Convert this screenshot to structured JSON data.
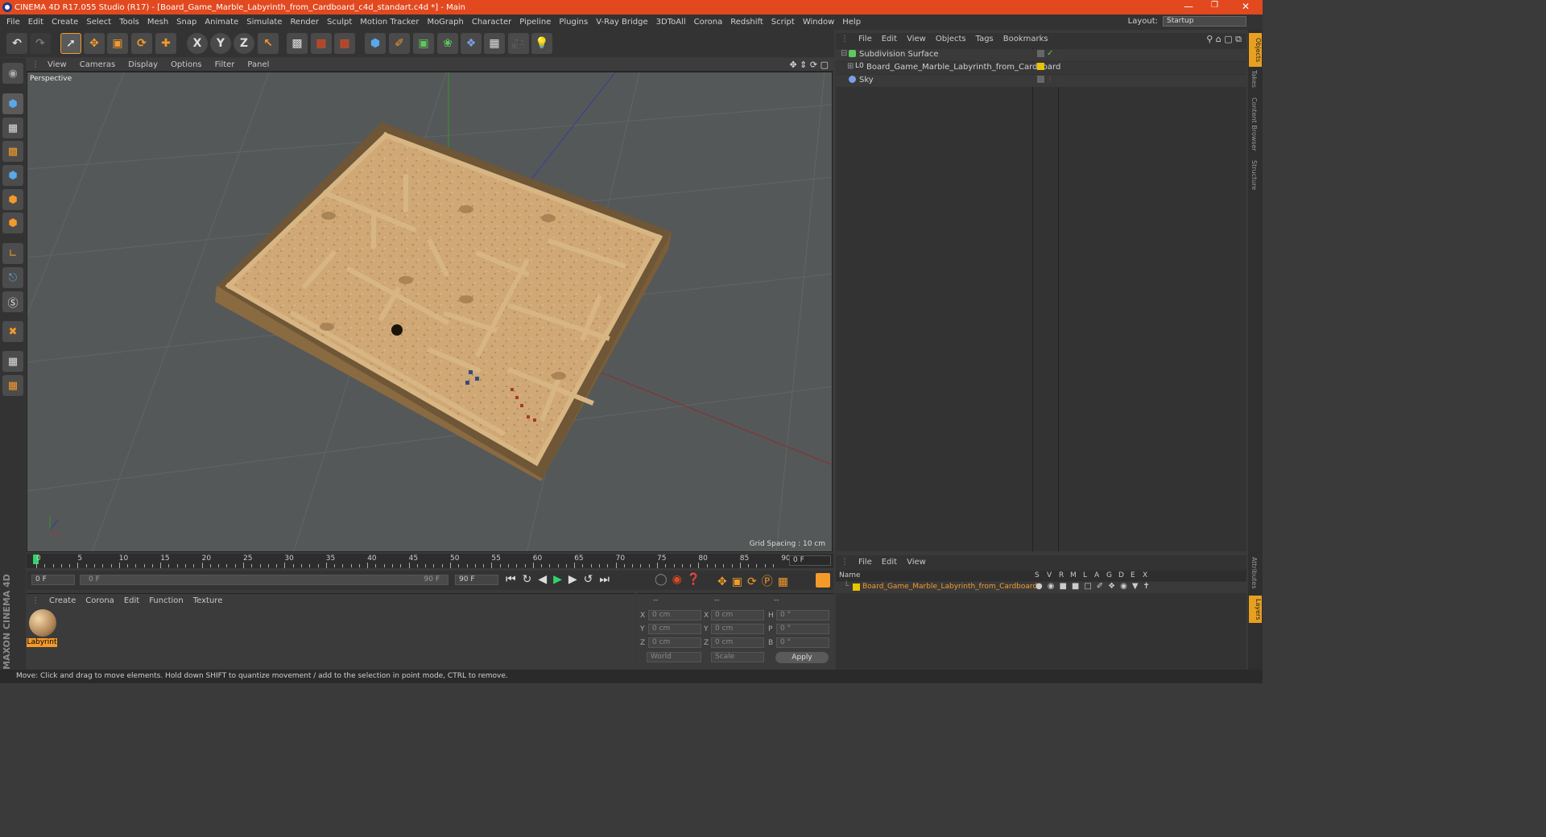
{
  "window": {
    "title": "CINEMA 4D R17.055 Studio (R17) - [Board_Game_Marble_Labyrinth_from_Cardboard_c4d_standart.c4d *] - Main"
  },
  "menu": [
    "File",
    "Edit",
    "Create",
    "Select",
    "Tools",
    "Mesh",
    "Snap",
    "Animate",
    "Simulate",
    "Render",
    "Sculpt",
    "Motion Tracker",
    "MoGraph",
    "Character",
    "Pipeline",
    "Plugins",
    "V-Ray Bridge",
    "3DToAll",
    "Corona",
    "Redshift",
    "Script",
    "Window",
    "Help"
  ],
  "layout": {
    "label": "Layout:",
    "value": "Startup"
  },
  "toolbar": {
    "axis_x": "X",
    "axis_y": "Y",
    "axis_z": "Z"
  },
  "viewport": {
    "menu": [
      "View",
      "Cameras",
      "Display",
      "Options",
      "Filter",
      "Panel"
    ],
    "camera_label": "Perspective",
    "grid_spacing": "Grid Spacing : 10 cm"
  },
  "timeline": {
    "ticks": [
      "0",
      "5",
      "10",
      "15",
      "20",
      "25",
      "30",
      "35",
      "40",
      "45",
      "50",
      "55",
      "60",
      "65",
      "70",
      "75",
      "80",
      "85",
      "90"
    ],
    "frame_field": "0 F",
    "start_field": "0 F",
    "range_start": "0 F",
    "range_end": "90 F",
    "end_field": "90 F"
  },
  "material_manager": {
    "menu": [
      "Create",
      "Corona",
      "Edit",
      "Function",
      "Texture"
    ],
    "material_name": "Labyrint"
  },
  "coords": {
    "headers": [
      "--",
      "--",
      "--"
    ],
    "rows": [
      {
        "a": "X",
        "av": "0 cm",
        "b": "X",
        "bv": "0 cm",
        "c": "H",
        "cv": "0 °"
      },
      {
        "a": "Y",
        "av": "0 cm",
        "b": "Y",
        "bv": "0 cm",
        "c": "P",
        "cv": "0 °"
      },
      {
        "a": "Z",
        "av": "0 cm",
        "b": "Z",
        "bv": "0 cm",
        "c": "B",
        "cv": "0 °"
      }
    ],
    "space": "World",
    "mode": "Scale",
    "apply": "Apply"
  },
  "object_manager": {
    "menu": [
      "File",
      "Edit",
      "View",
      "Objects",
      "Tags",
      "Bookmarks"
    ],
    "objects": [
      "Subdivision Surface",
      "Board_Game_Marble_Labyrinth_from_Cardboard",
      "Sky"
    ]
  },
  "layer_manager": {
    "menu": [
      "File",
      "Edit",
      "View"
    ],
    "columns": [
      "Name",
      "S",
      "V",
      "R",
      "M",
      "L",
      "A",
      "G",
      "D",
      "E",
      "X"
    ],
    "layer_name": "Board_Game_Marble_Labyrinth_from_Cardboard"
  },
  "side_tabs": [
    "Objects",
    "Takes",
    "Content Browser",
    "Structure"
  ],
  "side_tabs_bottom": [
    "Attributes",
    "Layers"
  ],
  "brand": "MAXON CINEMA 4D",
  "status": "Move: Click and drag to move elements. Hold down SHIFT to quantize movement / add to the selection in point mode, CTRL to remove.",
  "colors": {
    "title_bar": "#e2491f",
    "accent": "#f39a2b",
    "layer_yellow": "#e8c400"
  }
}
